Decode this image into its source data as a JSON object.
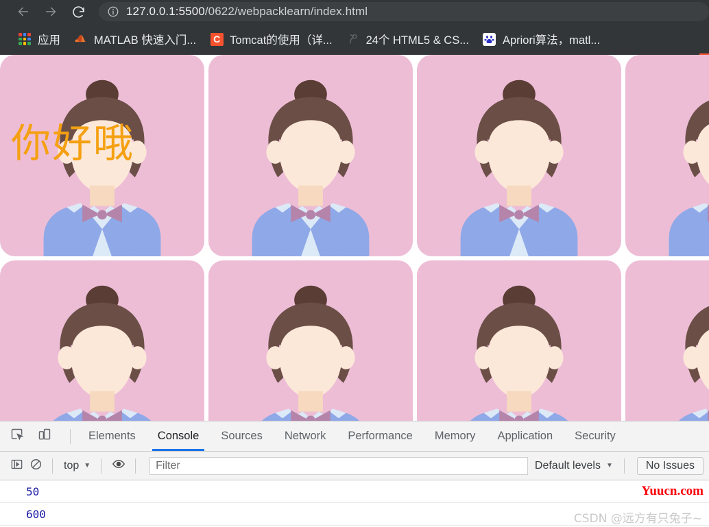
{
  "browser": {
    "nav": {
      "back_icon": "arrow-left-icon",
      "forward_icon": "arrow-right-icon",
      "reload_icon": "reload-icon",
      "info_icon": "info-circle-icon"
    },
    "omnibox": {
      "url_host": "127.0.0.1:5500",
      "url_path": "/0622/webpacklearn/index.html",
      "url_full": "127.0.0.1:5500/0622/webpacklearn/index.html"
    },
    "bookmarks": [
      {
        "label": "应用",
        "icon": "apps-grid-icon"
      },
      {
        "label": "MATLAB 快速入门...",
        "icon": "matlab-icon"
      },
      {
        "label": "Tomcat的使用（详...",
        "icon": "tomcat-icon"
      },
      {
        "label": "24个 HTML5 & CS...",
        "icon": "generic-bookmark-icon"
      },
      {
        "label": "Apriori算法，matl...",
        "icon": "baidu-icon"
      }
    ]
  },
  "page": {
    "greeting": "你好哦",
    "greeting_color": "#f5a011",
    "tile_count": 8,
    "avatar": {
      "background": "#edbdd6",
      "hair": "#6b4f47",
      "hair_bun": "#5a3d35",
      "face": "#fce8d8",
      "neck": "#f6d9bf",
      "vest": "#8fa8e8",
      "shirt": "#dce9f7",
      "bowtie": "#b584ab"
    }
  },
  "devtools": {
    "tool_icons": [
      {
        "name": "inspect-element-icon"
      },
      {
        "name": "device-toolbar-icon"
      }
    ],
    "tabs": [
      {
        "label": "Elements",
        "active": false
      },
      {
        "label": "Console",
        "active": true
      },
      {
        "label": "Sources",
        "active": false
      },
      {
        "label": "Network",
        "active": false
      },
      {
        "label": "Performance",
        "active": false
      },
      {
        "label": "Memory",
        "active": false
      },
      {
        "label": "Application",
        "active": false
      },
      {
        "label": "Security",
        "active": false
      }
    ],
    "active_tab": "Console",
    "accent_color": "#1a73e8",
    "filter_bar": {
      "sidebar_icon": "console-sidebar-icon",
      "clear_icon": "clear-console-icon",
      "context_value": "top",
      "eye_icon": "live-expression-icon",
      "filter_placeholder": "Filter",
      "filter_value": "",
      "levels_value": "Default levels",
      "issues_label": "No Issues"
    },
    "console_rows": [
      {
        "value": "50"
      },
      {
        "value": "600"
      }
    ]
  },
  "watermarks": {
    "top": "Yuucn.com",
    "top_color": "#fb0007",
    "bottom": "CSDN @远方有只兔子~",
    "bottom_color": "#c9c9c9"
  }
}
